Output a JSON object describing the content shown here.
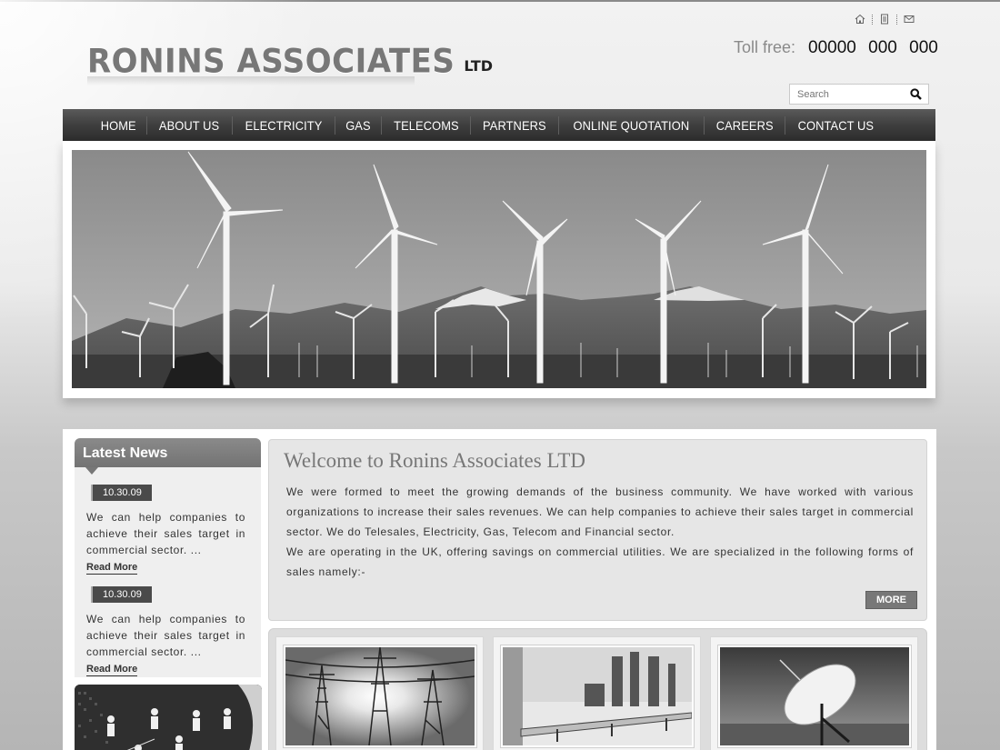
{
  "header": {
    "logo_main": "RONINS ASSOCIATES",
    "logo_sub": "LTD",
    "toll_free_label": "Toll free:",
    "toll_free_number": "00000 000 000",
    "search_placeholder": "Search",
    "top_icons": [
      "home-icon",
      "sitemap-icon",
      "mail-icon"
    ]
  },
  "nav": {
    "items": [
      "HOME",
      "ABOUT US",
      "ELECTRICITY",
      "GAS",
      "TELECOMS",
      "PARTNERS",
      "ONLINE QUOTATION",
      "CAREERS",
      "CONTACT US"
    ]
  },
  "sidebar": {
    "title": "Latest News",
    "news": [
      {
        "date": "10.30.09",
        "text": "We can help companies to achieve their sales target in commercial sector. ...",
        "link": "Read More"
      },
      {
        "date": "10.30.09",
        "text": "We can help companies to achieve their sales target in commercial sector. ...",
        "link": "Read More"
      }
    ]
  },
  "welcome": {
    "title": "Welcome to Ronins Associates LTD",
    "paragraph1": "We were formed to meet the growing demands of the business community. We have worked with various organizations to increase their sales revenues. We can help companies to achieve their sales target in commercial sector. We do Telesales, Electricity, Gas, Telecom and Financial sector.",
    "paragraph2": "We are operating in the UK, offering savings on commercial utilities. We are specialized in the following forms of sales namely:-",
    "more_label": "MORE"
  },
  "gallery": {
    "items": [
      "power-lines-image",
      "gas-plant-image",
      "satellite-dish-image"
    ]
  }
}
